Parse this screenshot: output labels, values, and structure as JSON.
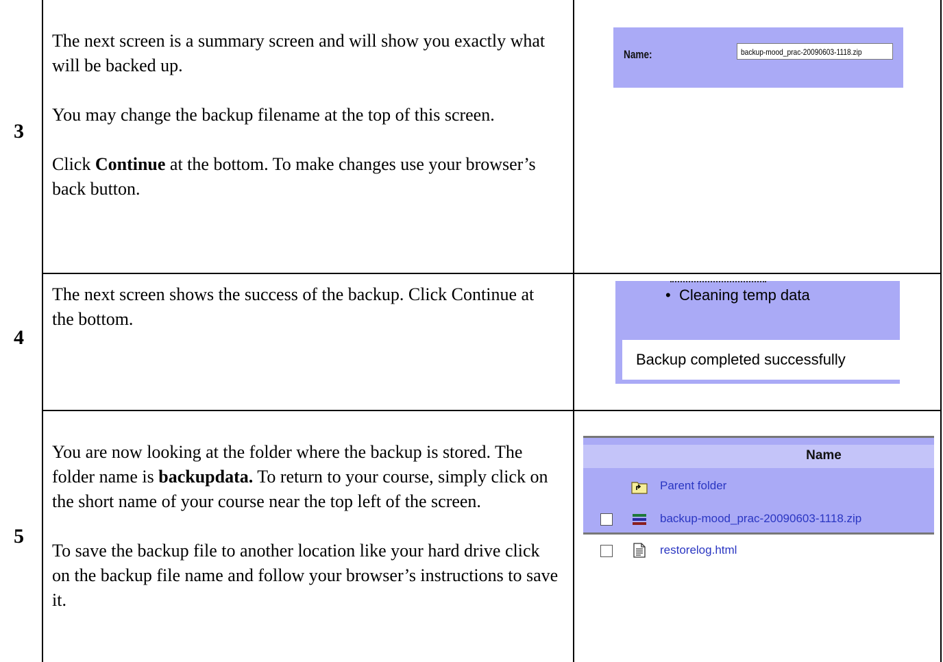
{
  "steps": [
    {
      "number": "3",
      "p1": "The next screen is a summary screen and will show you exactly what will be backed up.",
      "p2": "You may change the backup filename at the top of this screen.",
      "p3_bold": "Continue",
      "p3_pre": "Click ",
      "p3_post": " at the bottom. To make changes use your browser’s back button."
    },
    {
      "number": "4",
      "p1": "The next screen shows the success of the backup. Click Continue at the bottom."
    },
    {
      "number": "5",
      "p1_pre": "You are now looking at the folder where the backup is stored. The folder name is ",
      "p1_bold": "backupdata.",
      "p1_post": " To return to your course, simply click on the short name of your course near the top left of the screen.",
      "p2": "To save the backup file to another location like your hard drive click on the backup file name and follow your browser’s instructions to save it."
    }
  ],
  "shot_name": {
    "label": "Name:",
    "value": "backup-mood_prac-20090603-1118.zip"
  },
  "shot_success": {
    "bullet": "Cleaning temp data",
    "message": "Backup completed successfully"
  },
  "shot_files": {
    "header": "Name",
    "parent": "Parent folder",
    "files": [
      "backup-mood_prac-20090603-1118.zip",
      "restorelog.html"
    ]
  },
  "colors": {
    "panel": "#aaaaf6",
    "link": "#2a36c2"
  }
}
